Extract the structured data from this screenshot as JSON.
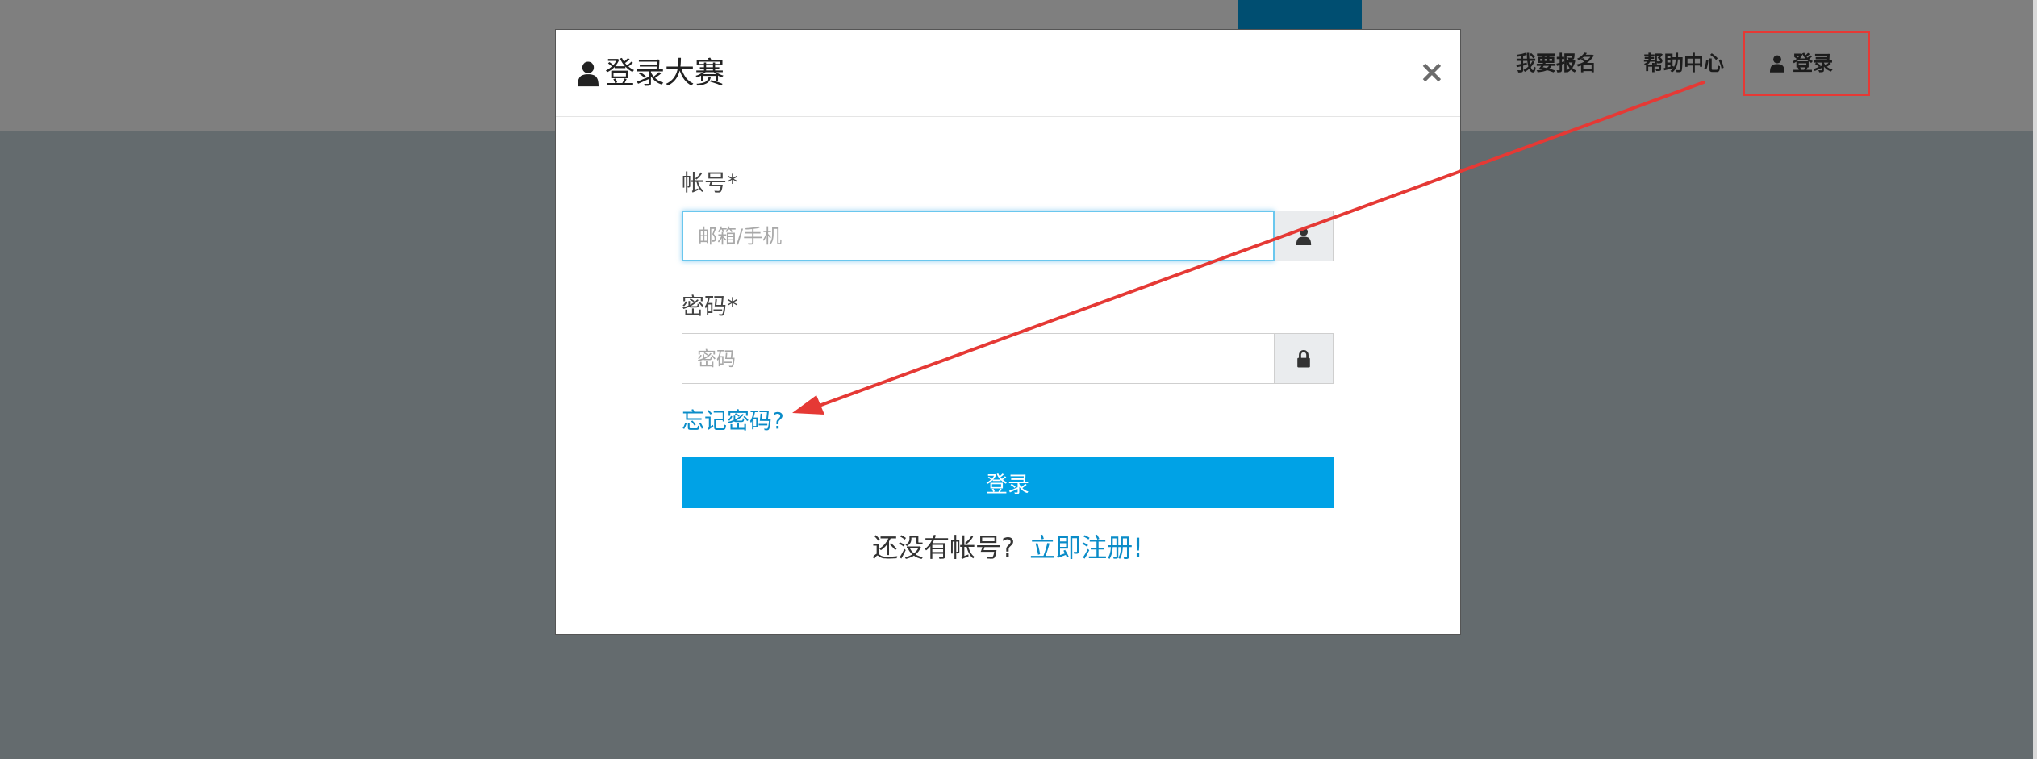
{
  "navbar": {
    "signup_label": "我要报名",
    "help_label": "帮助中心",
    "login_label": "登录",
    "login_icon": "user-icon"
  },
  "modal": {
    "title": "登录大赛",
    "title_icon": "user-icon",
    "close_symbol": "×",
    "account": {
      "label": "帐号*",
      "placeholder": "邮箱/手机",
      "value": "",
      "icon": "user-icon"
    },
    "password": {
      "label": "密码*",
      "placeholder": "密码",
      "value": "",
      "icon": "lock-icon"
    },
    "forgot_label": "忘记密码?",
    "submit_label": "登录",
    "register_prompt": "还没有帐号?",
    "register_link": "立即注册!"
  },
  "colors": {
    "backdrop": "#646b6e",
    "navbar_dimmed": "#7f7f7f",
    "nav_accent": "#004e71",
    "primary_button": "#00a2e6",
    "link": "#0a8cc8",
    "annotation": "#e53935"
  }
}
